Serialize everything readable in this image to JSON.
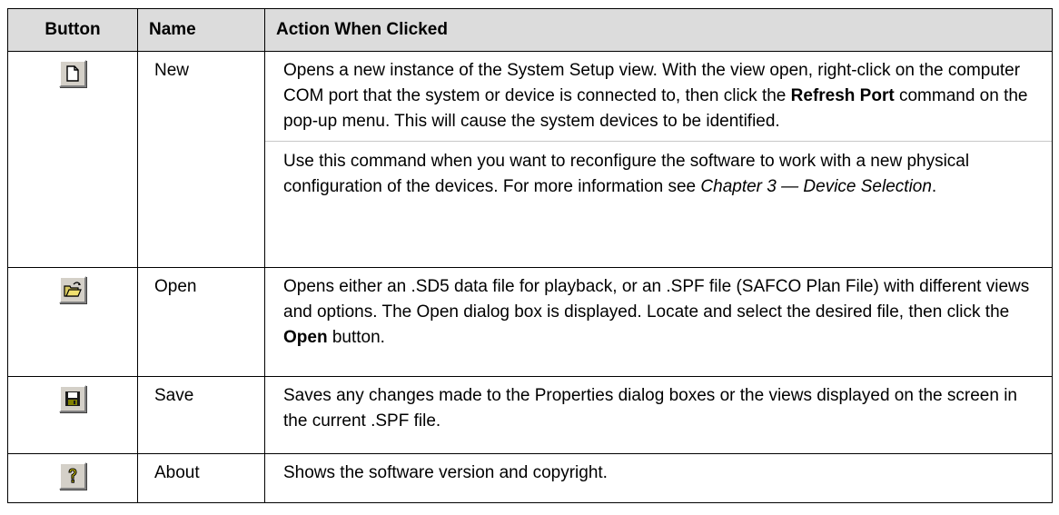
{
  "table": {
    "headers": {
      "button": "Button",
      "name": "Name",
      "action": "Action When Clicked"
    },
    "rows": [
      {
        "icon": "new-document-icon",
        "name": "New",
        "action": [
          [
            {
              "t": "Opens a new instance of the System Setup view. With the view open, right-click on the computer COM port that the system or device is connected to, then click the ",
              "s": ""
            },
            {
              "t": "Refresh Port",
              "s": "b"
            },
            {
              "t": " command on the pop-up menu. This will cause the system devices to be identified.",
              "s": ""
            }
          ],
          [
            {
              "t": "Use this command when you want to reconfigure the software to work with a new physical configuration of the devices. For more information see ",
              "s": ""
            },
            {
              "t": "Chapter 3 — Device Selection",
              "s": "i"
            },
            {
              "t": ".",
              "s": ""
            }
          ]
        ]
      },
      {
        "icon": "open-folder-icon",
        "name": "Open",
        "action": [
          [
            {
              "t": "Opens either an .SD5 data file for playback, or an .SPF file (SAFCO Plan File) with different views and options. The Open dialog box is displayed. Locate and select the desired file, then click the ",
              "s": ""
            },
            {
              "t": "Open",
              "s": "b"
            },
            {
              "t": " button.",
              "s": ""
            }
          ]
        ]
      },
      {
        "icon": "save-disk-icon",
        "name": "Save",
        "action": [
          [
            {
              "t": "Saves any changes made to the Properties dialog boxes or the views displayed on the screen in the current .SPF file.",
              "s": ""
            }
          ]
        ]
      },
      {
        "icon": "about-question-icon",
        "name": "About",
        "action": [
          [
            {
              "t": "Shows the software version and copyright.",
              "s": ""
            }
          ]
        ]
      }
    ]
  }
}
